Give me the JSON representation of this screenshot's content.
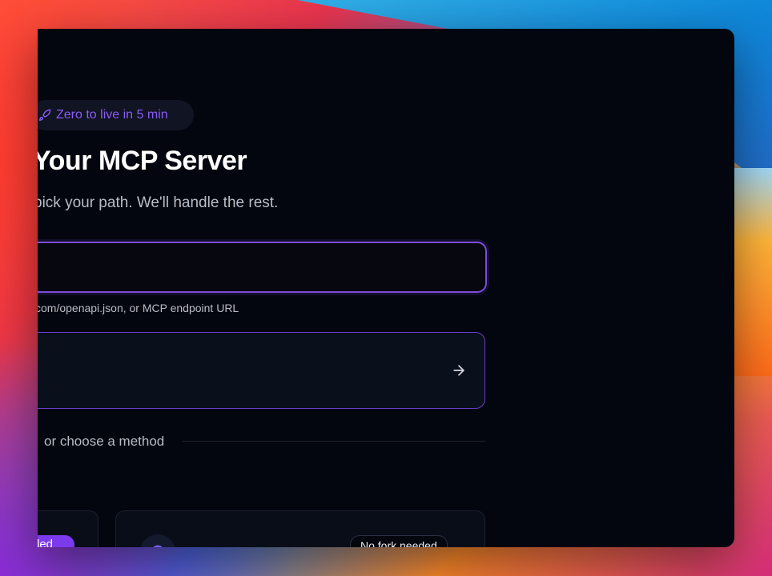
{
  "badge": {
    "icon": "rocket-icon",
    "text": "Zero to live in 5 min"
  },
  "header": {
    "title": "Your MCP Server",
    "subtitle": "pick your path. We'll handle the rest."
  },
  "url_input": {
    "value": "",
    "hint": "com/openapi.json, or MCP endpoint URL"
  },
  "submit_card": {
    "icon": "arrow-right-icon"
  },
  "divider": {
    "text": "or choose a method"
  },
  "methods": [
    {
      "tag": "ded"
    },
    {
      "icon": "globe-icon",
      "tag": "No fork needed"
    }
  ],
  "colors": {
    "accent": "#7c3aed",
    "accent_text": "#8b5cf6",
    "window_bg": "#03060e"
  }
}
